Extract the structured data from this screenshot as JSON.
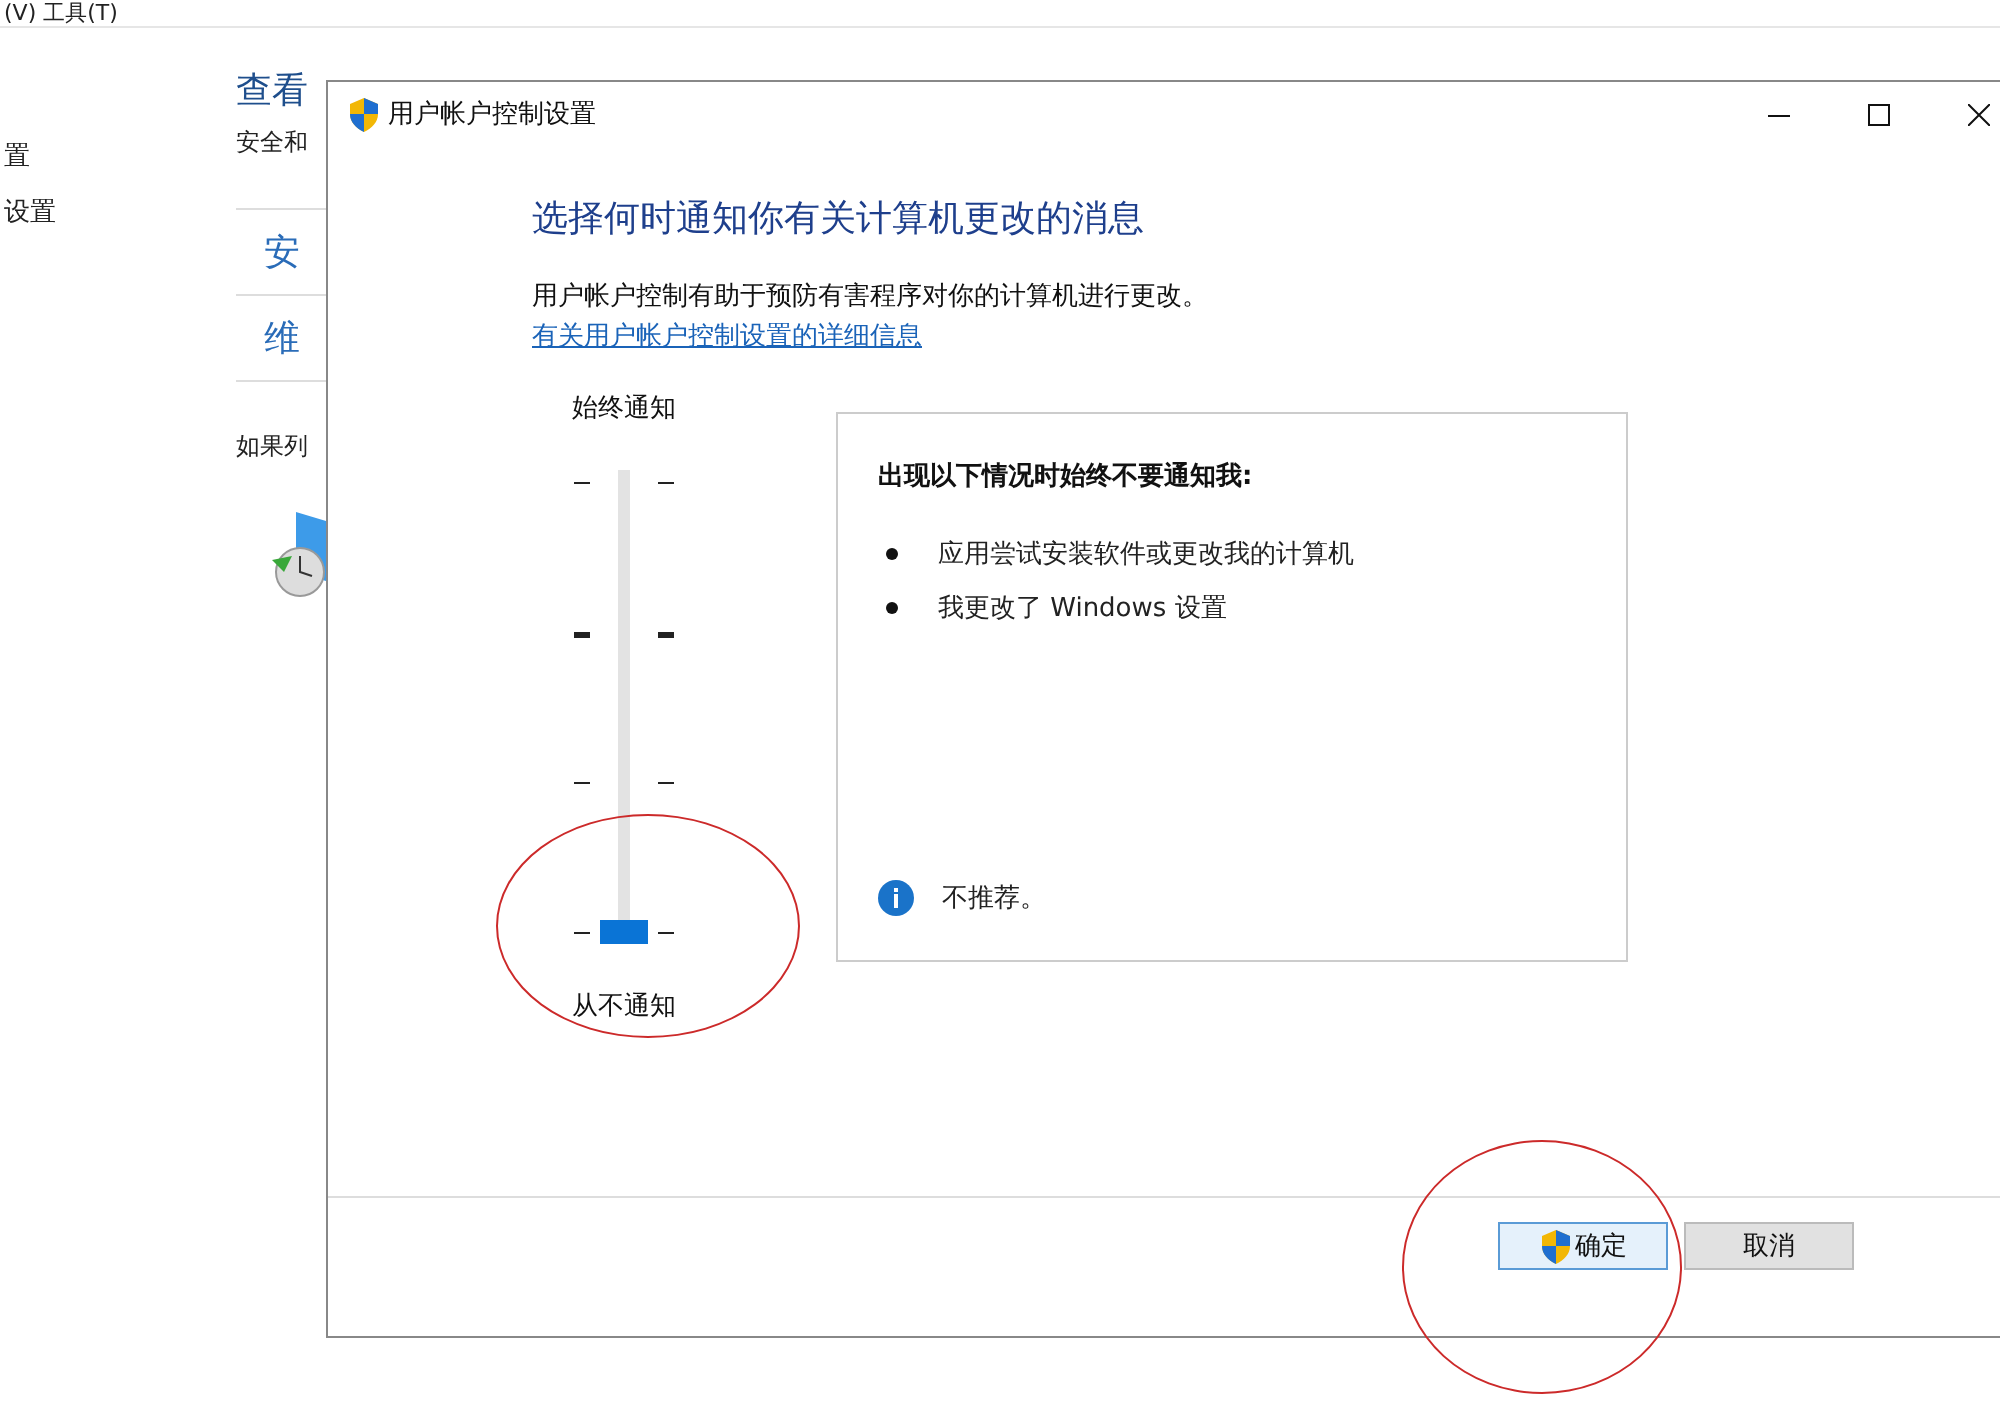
{
  "background_window": {
    "menu_text": "(V)  工具(T)",
    "sidebar_items": [
      "置",
      "设置"
    ],
    "heading": "查看",
    "subtitle": "安全和",
    "sections": [
      "安",
      "维"
    ],
    "note": "如果列"
  },
  "dialog": {
    "title": "用户帐户控制设置",
    "heading": "选择何时通知你有关计算机更改的消息",
    "description": "用户帐户控制有助于预防有害程序对你的计算机进行更改。",
    "link": "有关用户帐户控制设置的详细信息",
    "slider": {
      "top_label": "始终通知",
      "bottom_label": "从不通知",
      "level": 0
    },
    "info": {
      "title": "出现以下情况时始终不要通知我:",
      "items": [
        "应用尝试安装软件或更改我的计算机",
        "我更改了 Windows 设置"
      ],
      "recommendation": "不推荐。"
    },
    "buttons": [
      {
        "label": "确定",
        "kind": "shield",
        "focused": true
      },
      {
        "label": "取消",
        "kind": "plain",
        "focused": false
      }
    ]
  }
}
